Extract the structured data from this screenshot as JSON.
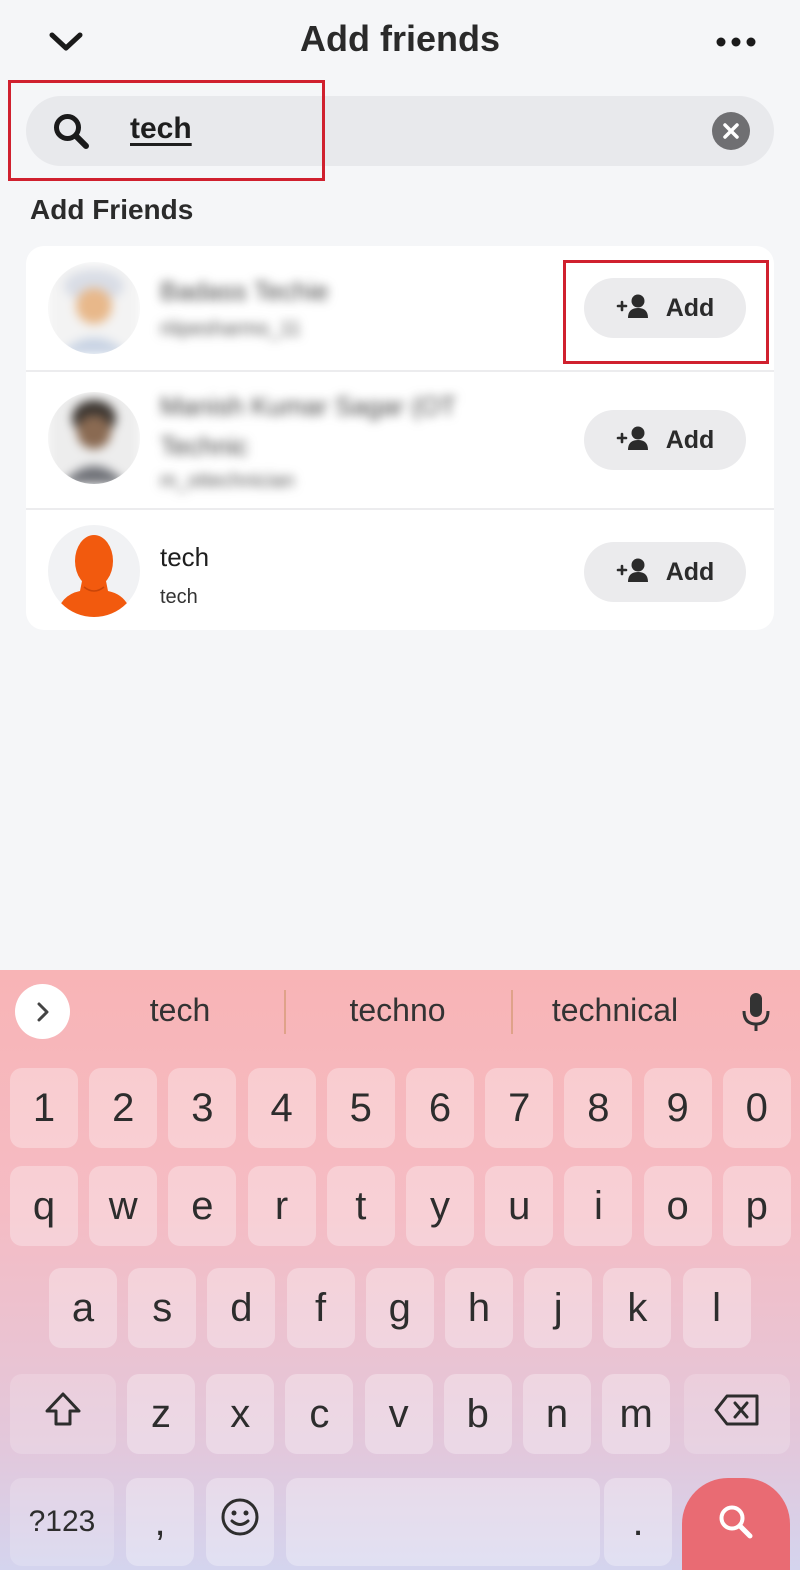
{
  "header": {
    "title": "Add friends",
    "back_icon": "chevron-down-icon",
    "more_icon": "more-horizontal-icon"
  },
  "search": {
    "query": "tech",
    "search_icon": "search-icon",
    "clear_icon": "clear-icon"
  },
  "section_title": "Add Friends",
  "results": [
    {
      "name": "Badass Techie",
      "username": "riiipesharmo_11",
      "blurred": true,
      "button": "Add"
    },
    {
      "name": "Manish Kumar Sagar (OT Technic",
      "username": "m_ottechnician",
      "blurred": true,
      "button": "Add"
    },
    {
      "name": "tech",
      "username": "tech",
      "blurred": false,
      "button": "Add"
    }
  ],
  "keyboard": {
    "suggestions": [
      "tech",
      "techno",
      "technical"
    ],
    "row_numbers": [
      "1",
      "2",
      "3",
      "4",
      "5",
      "6",
      "7",
      "8",
      "9",
      "0"
    ],
    "row_top": [
      "q",
      "w",
      "e",
      "r",
      "t",
      "y",
      "u",
      "i",
      "o",
      "p"
    ],
    "row_middle": [
      "a",
      "s",
      "d",
      "f",
      "g",
      "h",
      "j",
      "k",
      "l"
    ],
    "row_bottom": [
      "z",
      "x",
      "c",
      "v",
      "b",
      "n",
      "m"
    ],
    "symbols_key": "?123",
    "comma_key": ",",
    "period_key": "."
  },
  "colors": {
    "highlight": "#d0202e",
    "avatar_orange": "#f25a0e",
    "search_key": "#e96b73"
  }
}
